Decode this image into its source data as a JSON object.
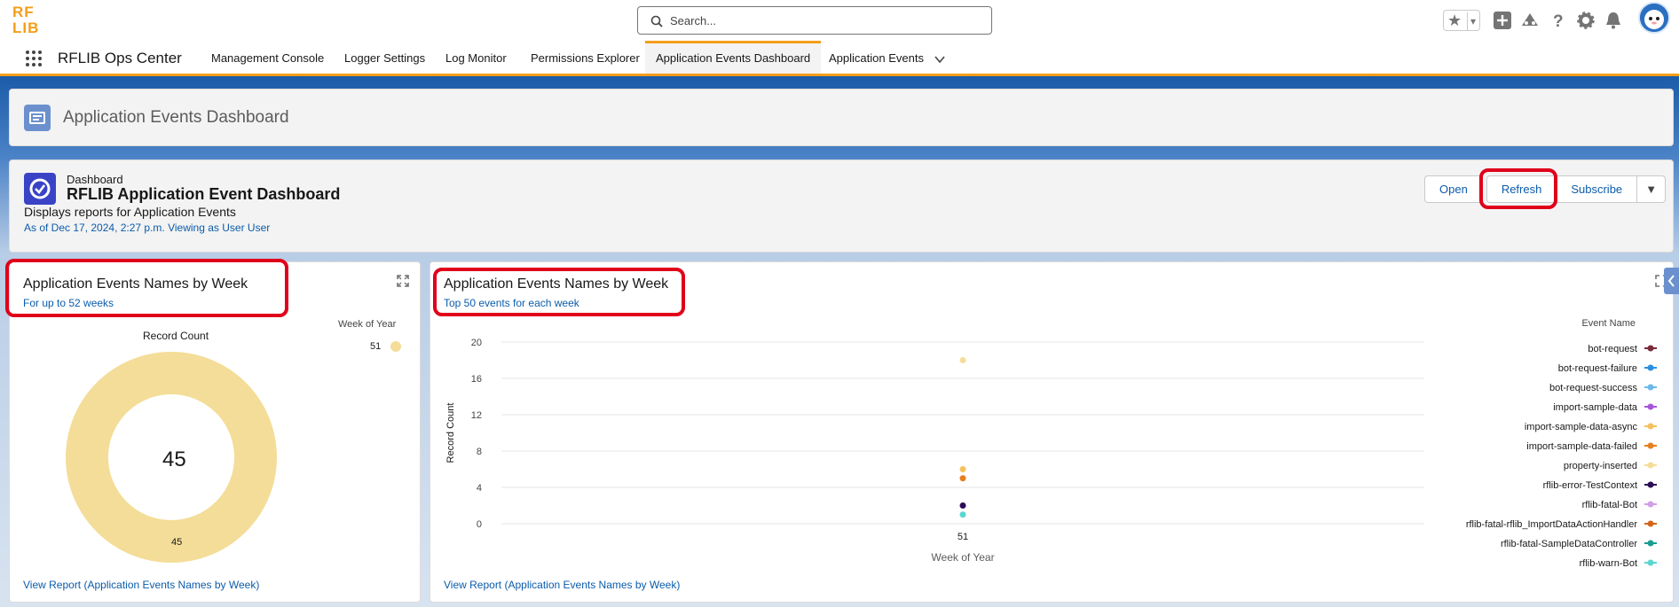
{
  "header": {
    "logo_text": "RFLIB",
    "search_placeholder": "Search..."
  },
  "nav": {
    "app_name": "RFLIB Ops Center",
    "items": [
      {
        "label": "Management Console"
      },
      {
        "label": "Logger Settings"
      },
      {
        "label": "Log Monitor"
      },
      {
        "label": "Permissions Explorer"
      },
      {
        "label": "Application Events Dashboard",
        "active": true
      },
      {
        "label": "Application Events"
      }
    ]
  },
  "page_header": {
    "title": "Application Events Dashboard"
  },
  "dashboard": {
    "kind": "Dashboard",
    "name": "RFLIB Application Event Dashboard",
    "description": "Displays reports for Application Events",
    "as_of": "As of Dec 17, 2024, 2:27 p.m. Viewing as User User",
    "buttons": {
      "open": "Open",
      "refresh": "Refresh",
      "subscribe": "Subscribe"
    }
  },
  "widget_left": {
    "title": "Application Events Names by Week",
    "subtitle": "For up to 52 weeks",
    "chart_title": "Record Count",
    "legend_title": "Week of Year",
    "legend_item": "51",
    "total": "45",
    "slice_label": "45",
    "link": "View Report (Application Events Names by Week)"
  },
  "widget_right": {
    "title": "Application Events Names by Week",
    "subtitle": "Top 50 events for each week",
    "legend_title": "Event Name",
    "link": "View Report (Application Events Names by Week)"
  },
  "colors": {
    "accent": "#f59d1a",
    "link": "#0b5cab",
    "highlight": "#e0001a",
    "donut": "#f4dd98"
  },
  "chart_data": [
    {
      "type": "pie",
      "title": "Record Count",
      "legend_title": "Week of Year",
      "categories": [
        "51"
      ],
      "values": [
        45
      ],
      "center_total": 45,
      "legend_position": "top-right"
    },
    {
      "type": "scatter",
      "xlabel": "Week of Year",
      "ylabel": "Record Count",
      "categories": [
        "51"
      ],
      "yticks": [
        0,
        4,
        8,
        12,
        16,
        20
      ],
      "ylim": [
        0,
        20
      ],
      "legend_title": "Event Name",
      "legend_position": "right",
      "series": [
        {
          "name": "bot-request",
          "color": "#7b2b3b",
          "values": [
            0
          ]
        },
        {
          "name": "bot-request-failure",
          "color": "#2a8fe0",
          "values": [
            0
          ]
        },
        {
          "name": "bot-request-success",
          "color": "#6cb9ec",
          "values": [
            0
          ]
        },
        {
          "name": "import-sample-data",
          "color": "#a955d8",
          "values": [
            0
          ]
        },
        {
          "name": "import-sample-data-async",
          "color": "#f5c15e",
          "values": [
            6
          ]
        },
        {
          "name": "import-sample-data-failed",
          "color": "#e57f1f",
          "values": [
            5
          ]
        },
        {
          "name": "property-inserted",
          "color": "#f4dd98",
          "values": [
            18
          ]
        },
        {
          "name": "rflib-error-TestContext",
          "color": "#2d0b55",
          "values": [
            2
          ]
        },
        {
          "name": "rflib-fatal-Bot",
          "color": "#d19fe8",
          "values": [
            0
          ]
        },
        {
          "name": "rflib-fatal-rflib_ImportDataActionHandler",
          "color": "#d4661a",
          "values": [
            0
          ]
        },
        {
          "name": "rflib-fatal-SampleDataController",
          "color": "#1a9e8f",
          "values": [
            0
          ]
        },
        {
          "name": "rflib-warn-Bot",
          "color": "#5ad6d0",
          "values": [
            1
          ]
        }
      ]
    }
  ]
}
